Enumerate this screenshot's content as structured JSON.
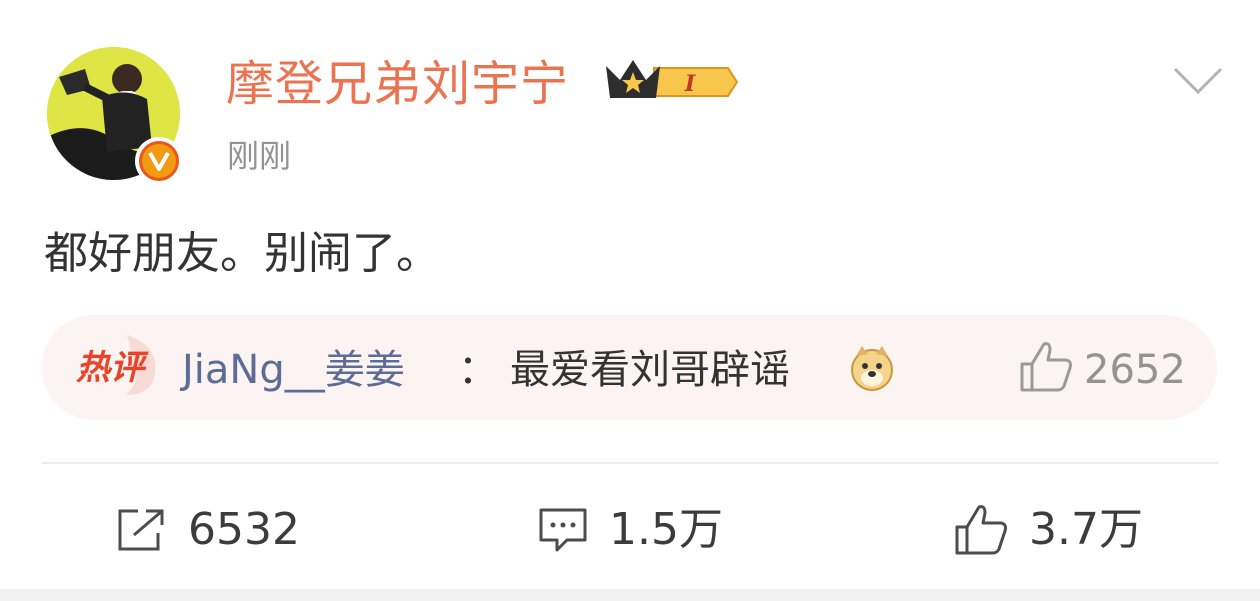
{
  "post": {
    "author": "摩登兄弟刘宇宁",
    "vip_level": "I",
    "time": "刚刚",
    "text": "都好朋友。别闹了。"
  },
  "hot_comment": {
    "badge": "热评",
    "user": "JiaNg__姜姜",
    "colon": "：",
    "text": "最爱看刘哥辟谣",
    "likes": "2652"
  },
  "actions": {
    "repost_count": "6532",
    "comment_count": "1.5万",
    "like_count": "3.7万"
  },
  "colors": {
    "username": "#eb7350",
    "comment_user": "#5d6c95",
    "hot_badge": "#e9442a",
    "muted": "#939393"
  },
  "icons": [
    "avatar",
    "verified-v-icon",
    "crown-vip-icon",
    "chevron-down-icon",
    "hot-comment-icon",
    "doge-emoji-icon",
    "thumb-up-icon",
    "repost-icon",
    "comment-icon"
  ]
}
